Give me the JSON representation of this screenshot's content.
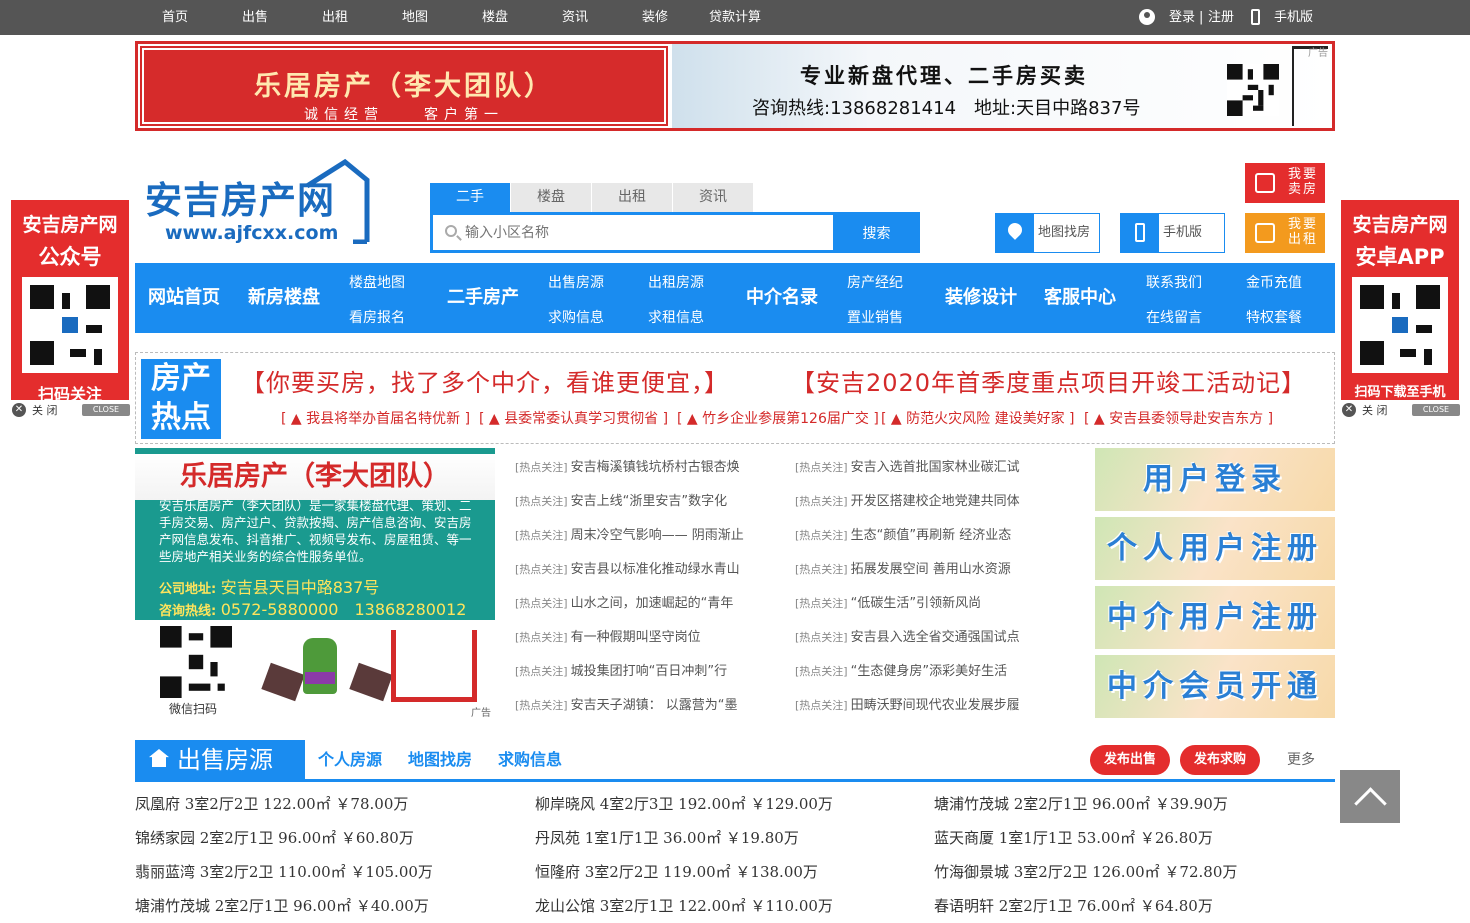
{
  "topnav": {
    "items": [
      "首页",
      "出售",
      "出租",
      "地图",
      "楼盘",
      "资讯",
      "装修",
      "贷款计算"
    ],
    "login": "登录",
    "register": "注册",
    "sep": "|",
    "mobile": "手机版"
  },
  "banner": {
    "left_title": "乐居房产（李大团队）",
    "left_sub": "诚信经营　　客户第一",
    "right_title": "专业新盘代理、二手房买卖",
    "right_contact": "咨询热线:13868281414　地址:天目中路837号",
    "ad_tag": "广告"
  },
  "logo": {
    "name": "安吉房产网",
    "url": "www.ajfcxx.com"
  },
  "search": {
    "tabs": [
      "二手",
      "楼盘",
      "出租",
      "资讯"
    ],
    "placeholder": "输入小区名称",
    "button": "搜索"
  },
  "header_buttons": {
    "map": "地图找房",
    "mobile": "手机版",
    "sell": "我要卖房",
    "rent": "我要出租"
  },
  "nav": {
    "main": [
      "网站首页",
      "新房楼盘",
      "二手房产",
      "中介名录",
      "装修设计",
      "客服中心"
    ],
    "sub": {
      "loupan_map": "楼盘地图",
      "kanfang": "看房报名",
      "chushou": "出售房源",
      "qiugou": "求购信息",
      "chuzu": "出租房源",
      "qiuzu": "求租信息",
      "jingji": "房产经纪",
      "zhiye": "置业销售",
      "lianxi": "联系我们",
      "liuyan": "在线留言",
      "jinbi": "金币充值",
      "tese": "特权套餐"
    }
  },
  "hot": {
    "label1": "房产",
    "label2": "热点",
    "big1": "【你要买房，找了多个中介，看谁更便宜，】",
    "big2": "【安吉2020年首季度重点项目开竣工活动记】",
    "small": [
      "▲ 我县将举办首届名特优新",
      "▲ 县委常委认真学习贯彻省",
      "▲ 竹乡企业参展第126届广交",
      "▲ 防范火灾风险 建设美好家",
      "▲ 安吉县委领导赴安吉东方"
    ],
    "lb": "[",
    "rb": "]"
  },
  "side_left": {
    "title": "安吉房产网",
    "sub": "公众号",
    "foot": "扫码关注",
    "close": "关 闭",
    "close_en": "CLOSE"
  },
  "side_right": {
    "title": "安吉房产网",
    "sub": "安卓APP",
    "foot": "扫码下载至手机",
    "close": "关 闭",
    "close_en": "CLOSE"
  },
  "company_ad": {
    "title": "乐居房产（李大团队）",
    "desc": "安吉乐居房产（李大团队）是一家集楼盘代理、策划、二手房交易、房产过户、贷款按揭、房产信息咨询、安吉房产网信息发布、抖音推广、视频号发布、房屋租赁、等一些房地产相关业务的综合性服务单位。",
    "addr_label": "公司地址:",
    "addr": "安吉县天目中路837号",
    "phone_label": "咨询热线:",
    "phone": "0572-5880000　13868280012",
    "wechat": "微信扫码",
    "ad_tag": "广告"
  },
  "news": {
    "tag": "[热点关注]",
    "col1": [
      "安吉梅溪镇钱坑桥村古银杏焕",
      "安吉上线“浙里安吉”数字化",
      "周末冷空气影响—— 阴雨渐止",
      "安吉县以标准化推动绿水青山",
      "山水之间，加速崛起的“青年",
      "有一种假期叫坚守岗位",
      "城投集团打响“百日冲刺”行",
      "安吉天子湖镇： 以露营为“墨"
    ],
    "col2": [
      "安吉入选首批国家林业碳汇试",
      "开发区搭建校企地党建共同体",
      "生态“颜值”再刷新 经济业态",
      "拓展发展空间 善用山水资源",
      "“低碳生活”引领新风尚",
      "安吉县入选全省交通强国试点",
      "“生态健身房”添彩美好生活",
      "田畴沃野间现代农业发展步履"
    ]
  },
  "right_boxes": [
    "用户登录",
    "个人用户注册",
    "中介用户注册",
    "中介会员开通"
  ],
  "sale": {
    "title": "出售房源",
    "links": [
      "个人房源",
      "地图找房",
      "求购信息"
    ],
    "publish_sell": "发布出售",
    "publish_buy": "发布求购",
    "more": "更多",
    "col1": [
      "凤凰府 3室2厅2卫 122.00㎡ ￥78.00万",
      "锦绣家园 2室2厅1卫 96.00㎡ ￥60.80万",
      "翡丽蓝湾 3室2厅2卫 110.00㎡ ￥105.00万",
      "塘浦竹茂城 2室2厅1卫 96.00㎡ ￥40.00万"
    ],
    "col2": [
      "柳岸晓风 4室2厅3卫 192.00㎡ ￥129.00万",
      "丹凤苑 1室1厅1卫 36.00㎡ ￥19.80万",
      "恒隆府 3室2厅2卫 119.00㎡ ￥138.00万",
      "龙山公馆 3室2厅1卫 122.00㎡ ￥110.00万"
    ],
    "col3": [
      "塘浦竹茂城 2室2厅1卫 96.00㎡ ￥39.90万",
      "蓝天商厦 1室1厅1卫 53.00㎡ ￥26.80万",
      "竹海御景城 3室2厅2卫 126.00㎡ ￥72.80万",
      "春语明轩 2室2厅1卫 76.00㎡ ￥64.80万"
    ]
  },
  "colors": {
    "brand": "#1a8cf0",
    "red": "#d42a2a",
    "top": "#555555"
  }
}
